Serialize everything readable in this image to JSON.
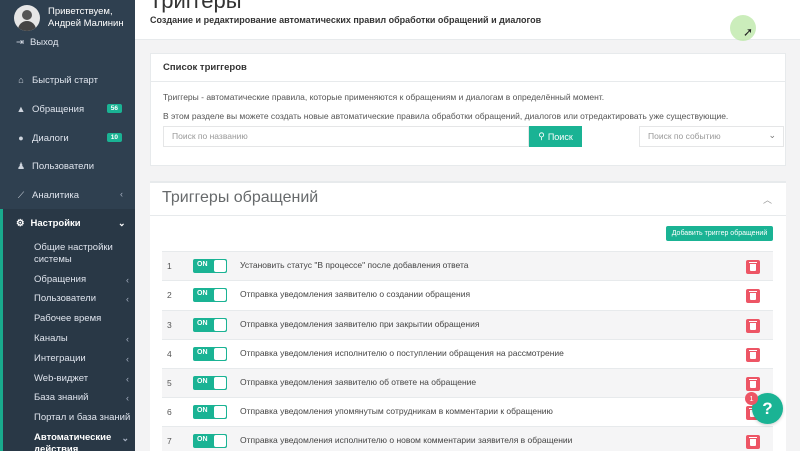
{
  "user": {
    "greeting": "Приветствуем,",
    "name": "Андрей Малинин"
  },
  "nav": {
    "logout": "Выход",
    "items": [
      {
        "label": "Быстрый старт",
        "icon": "home-icon"
      },
      {
        "label": "Обращения",
        "icon": "warning-icon",
        "badge": "56"
      },
      {
        "label": "Диалоги",
        "icon": "chat-icon",
        "badge": "10"
      },
      {
        "label": "Пользователи",
        "icon": "users-icon"
      },
      {
        "label": "Аналитика",
        "icon": "chart-icon",
        "arrow": "‹"
      }
    ],
    "settings": {
      "label": "Настройки",
      "arrow": "⌄",
      "items": [
        {
          "label": "Общие настройки системы"
        },
        {
          "label": "Обращения",
          "arrow": "‹"
        },
        {
          "label": "Пользователи",
          "arrow": "‹"
        },
        {
          "label": "Рабочее время"
        },
        {
          "label": "Каналы",
          "arrow": "‹"
        },
        {
          "label": "Интеграции",
          "arrow": "‹"
        },
        {
          "label": "Web-виджет",
          "arrow": "‹"
        },
        {
          "label": "База знаний",
          "arrow": "‹"
        },
        {
          "label": "Портал и база знаний"
        },
        {
          "label": "Автоматические действия",
          "arrow": "⌄"
        }
      ]
    }
  },
  "header": {
    "title": "Триггеры",
    "subtitle": "Создание и редактирование автоматических правил обработки обращений и диалогов"
  },
  "list_panel": {
    "title": "Список триггеров",
    "desc1": "Триггеры - автоматические правила, которые применяются к обращениям и диалогам в определённый момент.",
    "desc2": "В этом разделе вы можете создать новые автоматические правила обработки обращений, диалогов или отредактировать уже существующие.",
    "search_placeholder": "Поиск по названию",
    "search_button": "Поиск",
    "event_placeholder": "Поиск по событию"
  },
  "triggers_panel": {
    "title": "Триггеры обращений",
    "add_button": "Добавить триггер обращений",
    "toggle_label": "ON",
    "rows": [
      {
        "num": "1",
        "name": "Установить статус \"В процессе\" после добавления ответа"
      },
      {
        "num": "2",
        "name": "Отправка уведомления заявителю о создании обращения"
      },
      {
        "num": "3",
        "name": "Отправка уведомления заявителю при закрытии обращения"
      },
      {
        "num": "4",
        "name": "Отправка уведомления исполнителю о поступлении обращения на рассмотрение"
      },
      {
        "num": "5",
        "name": "Отправка уведомления заявителю об ответе на обращение"
      },
      {
        "num": "6",
        "name": "Отправка уведомления упомянутым сотрудникам в комментарии к обращению"
      },
      {
        "num": "7",
        "name": "Отправка уведомления исполнителю о новом комментарии заявителя в обращении"
      }
    ]
  },
  "help": {
    "label": "?",
    "badge": "1"
  },
  "colors": {
    "sidebar": "#2f4050",
    "accent": "#1ab394",
    "danger": "#ed5565"
  }
}
